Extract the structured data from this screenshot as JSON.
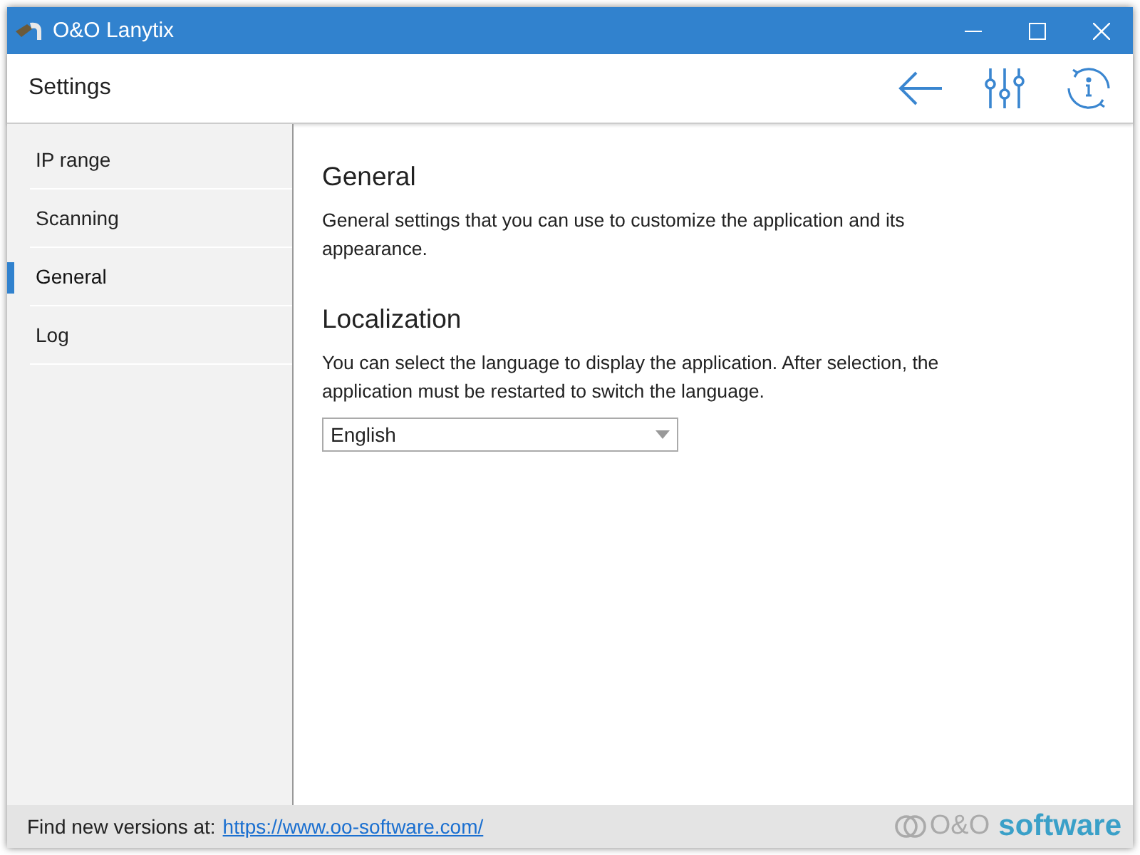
{
  "window": {
    "title": "O&O Lanytix"
  },
  "header": {
    "title": "Settings"
  },
  "sidebar": {
    "items": [
      {
        "label": "IP range",
        "selected": false
      },
      {
        "label": "Scanning",
        "selected": false
      },
      {
        "label": "General",
        "selected": true
      },
      {
        "label": "Log",
        "selected": false
      }
    ]
  },
  "content": {
    "sections": [
      {
        "heading": "General",
        "text": "General settings that you can use to customize the application and its appearance."
      },
      {
        "heading": "Localization",
        "text": "You can select the language to display the application. After selection, the application must be restarted to switch the language.",
        "dropdown": {
          "value": "English"
        }
      }
    ]
  },
  "footer": {
    "label": "Find new versions at:",
    "link": "https://www.oo-software.com/",
    "logo": {
      "prefix": "O&O",
      "name": "software"
    }
  }
}
